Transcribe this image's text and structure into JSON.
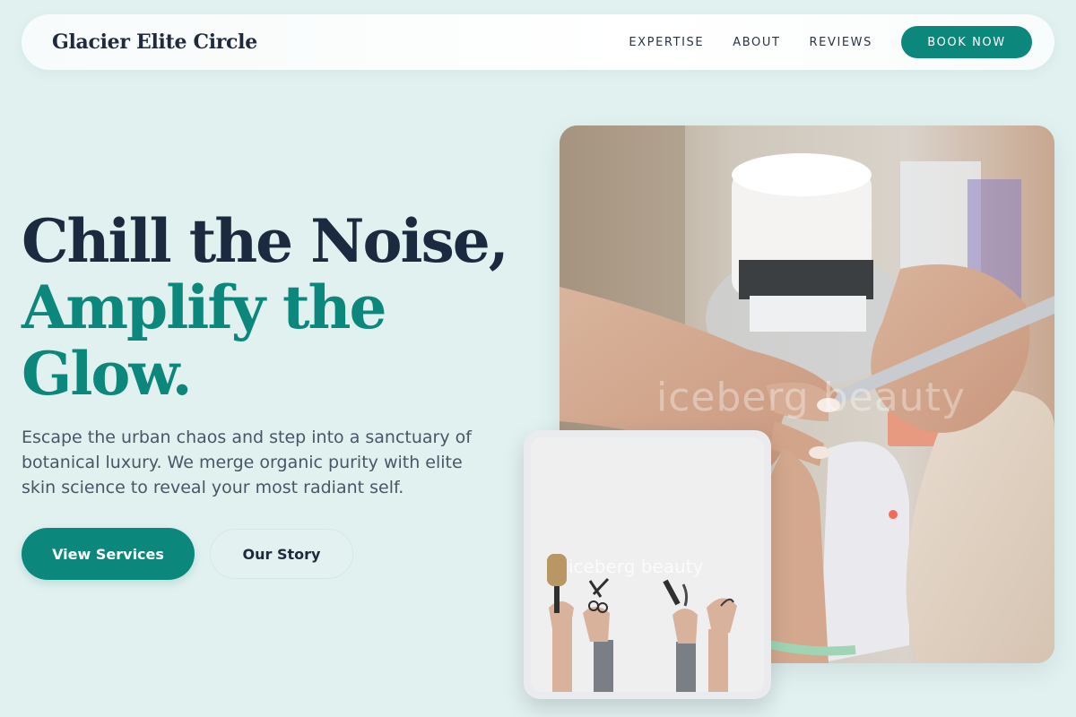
{
  "nav": {
    "brand": "Glacier Elite Circle",
    "links": [
      "EXPERTISE",
      "ABOUT",
      "REVIEWS"
    ],
    "cta": "BOOK NOW"
  },
  "hero": {
    "headline_line1": "Chill the Noise,",
    "headline_line2": "Amplify the",
    "headline_line3": "Glow.",
    "subtext": "Escape the urban chaos and step into a sanctuary of botanical luxury. We merge organic purity with elite skin science to reveal your most radiant self.",
    "primary_button": "View Services",
    "secondary_button": "Our Story"
  },
  "images": {
    "main_watermark": "iceberg beauty",
    "card_watermark": "iceberg beauty"
  },
  "colors": {
    "background": "#e1f1f0",
    "accent": "#0c877c",
    "heading_dark": "#1c2a40",
    "body_text": "#4a5566"
  }
}
